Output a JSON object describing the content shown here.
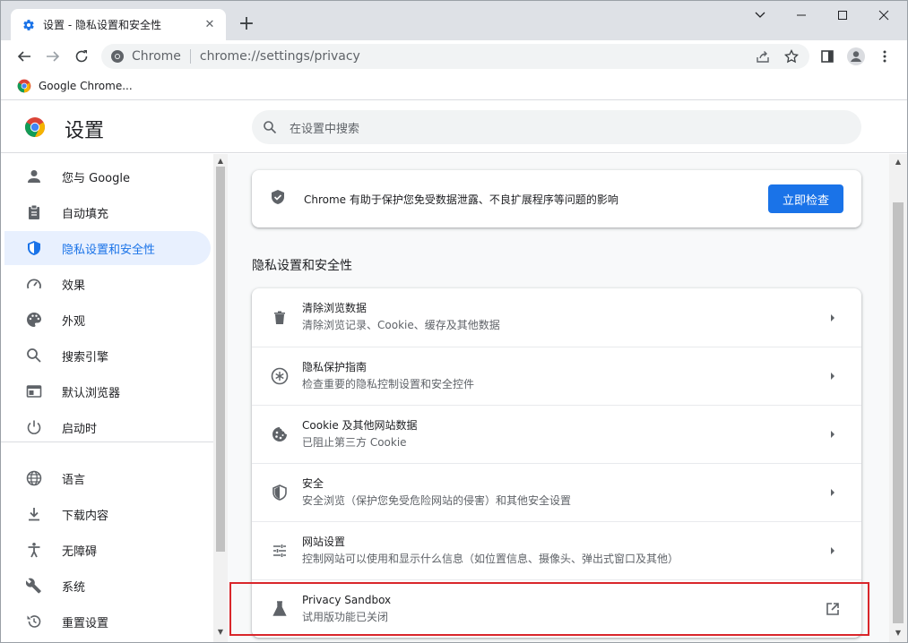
{
  "tab": {
    "title": "设置 - 隐私设置和安全性",
    "close": "✕",
    "new_tab": "+"
  },
  "omnibox": {
    "site": "Chrome",
    "url": "chrome://settings/privacy"
  },
  "bookmarks": {
    "items": [
      {
        "label": "Google Chrome..."
      }
    ]
  },
  "header": {
    "title": "设置",
    "search_placeholder": "在设置中搜索"
  },
  "sidebar": {
    "items": [
      {
        "label": "您与 Google",
        "icon": "person-icon"
      },
      {
        "label": "自动填充",
        "icon": "clipboard-icon"
      },
      {
        "label": "隐私设置和安全性",
        "icon": "shield-icon",
        "active": true
      },
      {
        "label": "效果",
        "icon": "speedometer-icon"
      },
      {
        "label": "外观",
        "icon": "palette-icon"
      },
      {
        "label": "搜索引擎",
        "icon": "search-icon"
      },
      {
        "label": "默认浏览器",
        "icon": "browser-window-icon"
      },
      {
        "label": "启动时",
        "icon": "power-icon"
      },
      {
        "label": "语言",
        "icon": "globe-icon"
      },
      {
        "label": "下载内容",
        "icon": "download-icon"
      },
      {
        "label": "无障碍",
        "icon": "accessibility-icon"
      },
      {
        "label": "系统",
        "icon": "wrench-icon"
      },
      {
        "label": "重置设置",
        "icon": "restore-icon"
      }
    ]
  },
  "safety_check": {
    "message": "Chrome 有助于保护您免受数据泄露、不良扩展程序等问题的影响",
    "button": "立即检查"
  },
  "section": {
    "title": "隐私设置和安全性",
    "rows": [
      {
        "title": "清除浏览数据",
        "subtitle": "清除浏览记录、Cookie、缓存及其他数据",
        "icon": "trash-icon",
        "action": "chevron-right-icon"
      },
      {
        "title": "隐私保护指南",
        "subtitle": "检查重要的隐私控制设置和安全控件",
        "icon": "privacy-guide-icon",
        "action": "chevron-right-icon"
      },
      {
        "title": "Cookie 及其他网站数据",
        "subtitle": "已阻止第三方 Cookie",
        "icon": "cookie-icon",
        "action": "chevron-right-icon"
      },
      {
        "title": "安全",
        "subtitle": "安全浏览（保护您免受危险网站的侵害）和其他安全设置",
        "icon": "security-shield-icon",
        "action": "chevron-right-icon"
      },
      {
        "title": "网站设置",
        "subtitle": "控制网站可以使用和显示什么信息（如位置信息、摄像头、弹出式窗口及其他）",
        "icon": "tune-icon",
        "action": "chevron-right-icon"
      },
      {
        "title": "Privacy Sandbox",
        "subtitle": "试用版功能已关闭",
        "icon": "flask-icon",
        "action": "open-external-icon"
      }
    ]
  },
  "colors": {
    "accent": "#1a73e8",
    "highlight": "#d9262b",
    "active_bg": "#e8f0fe"
  }
}
